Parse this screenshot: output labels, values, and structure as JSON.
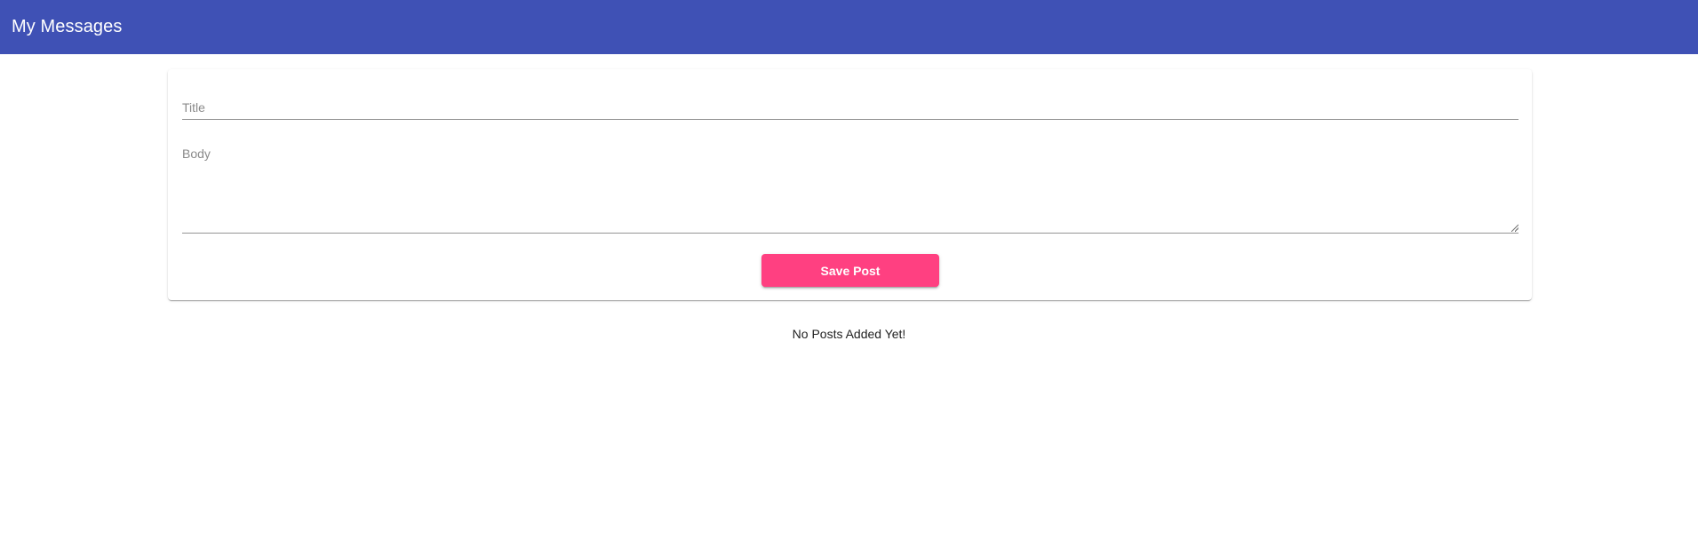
{
  "toolbar": {
    "title": "My Messages",
    "color": "#3f51b5"
  },
  "form": {
    "title_placeholder": "Title",
    "title_value": "",
    "body_placeholder": "Body",
    "body_value": "",
    "save_label": "Save Post",
    "save_color": "#ff4081"
  },
  "posts": {
    "empty_message": "No Posts Added Yet!",
    "items": []
  },
  "icons": {
    "resize_grip": "resize-grip-icon"
  }
}
